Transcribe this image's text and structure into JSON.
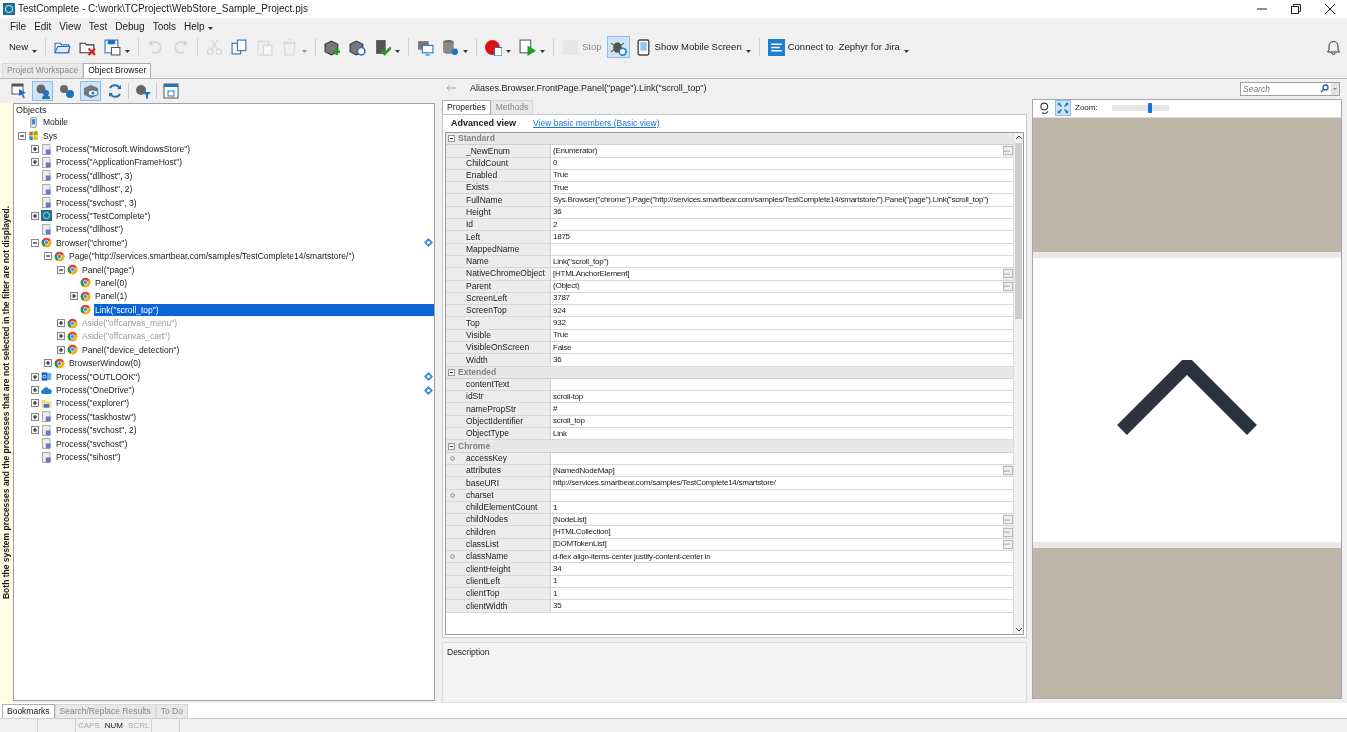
{
  "window": {
    "title": "TestComplete - C:\\work\\TCProject\\WebStore_Sample_Project.pjs"
  },
  "menu": [
    "File",
    "Edit",
    "View",
    "Test",
    "Debug",
    "Tools",
    "Help"
  ],
  "toolbar": [
    {
      "kind": "button",
      "label": "New",
      "disabled": false,
      "pressed": false,
      "dropdown": true
    },
    {
      "kind": "separator"
    },
    {
      "kind": "button",
      "disabled": false,
      "pressed": false,
      "dropdown": false
    },
    {
      "kind": "button",
      "disabled": false,
      "pressed": false,
      "dropdown": false
    },
    {
      "kind": "button",
      "disabled": false,
      "pressed": false,
      "dropdown": true
    },
    {
      "kind": "separator"
    },
    {
      "kind": "button",
      "disabled": true,
      "pressed": false,
      "dropdown": false
    },
    {
      "kind": "button",
      "disabled": true,
      "pressed": false,
      "dropdown": false
    },
    {
      "kind": "separator"
    },
    {
      "kind": "button",
      "disabled": true,
      "pressed": false,
      "dropdown": false
    },
    {
      "kind": "button",
      "disabled": false,
      "pressed": false,
      "dropdown": false
    },
    {
      "kind": "button",
      "disabled": true,
      "pressed": false,
      "dropdown": false
    },
    {
      "kind": "button",
      "disabled": true,
      "pressed": false,
      "dropdown": true
    },
    {
      "kind": "separator"
    },
    {
      "kind": "button",
      "disabled": false,
      "pressed": false,
      "dropdown": false
    },
    {
      "kind": "button",
      "disabled": false,
      "pressed": false,
      "dropdown": false
    },
    {
      "kind": "button",
      "disabled": false,
      "pressed": false,
      "dropdown": true
    },
    {
      "kind": "separator"
    },
    {
      "kind": "button",
      "disabled": false,
      "pressed": false,
      "dropdown": false
    },
    {
      "kind": "button",
      "disabled": false,
      "pressed": false,
      "dropdown": true
    },
    {
      "kind": "separator"
    },
    {
      "kind": "button",
      "disabled": false,
      "pressed": false,
      "dropdown": true
    },
    {
      "kind": "button",
      "disabled": false,
      "pressed": false,
      "dropdown": true
    },
    {
      "kind": "separator"
    },
    {
      "kind": "button",
      "label": "Stop",
      "disabled": true,
      "pressed": false,
      "dropdown": false
    },
    {
      "kind": "button",
      "disabled": false,
      "pressed": true,
      "dropdown": false
    },
    {
      "kind": "button",
      "label": "Show Mobile Screen",
      "disabled": false,
      "pressed": false,
      "dropdown": true
    },
    {
      "kind": "separator"
    },
    {
      "kind": "button",
      "label": "Connect to",
      "target": "Zephyr for Jira",
      "disabled": false,
      "pressed": false,
      "dropdown": true
    }
  ],
  "workspace_tabs": [
    {
      "label": "Project Workspace",
      "selected": false
    },
    {
      "label": "Object Browser",
      "selected": true
    }
  ],
  "object_toolbar": [
    {
      "pressed": false
    },
    {
      "pressed": true
    },
    {
      "pressed": false
    },
    {
      "pressed": true
    },
    {
      "pressed": false
    },
    {
      "pressed": false
    },
    {
      "pressed": false
    }
  ],
  "filter_note": "Both the system processes and the processes that are not selected in the filter are not displayed.",
  "tree": {
    "header": "Objects",
    "items": [
      {
        "label": "Mobile",
        "kind": "mobile",
        "expandable": false,
        "selected": false,
        "dimmed": false,
        "mapped": false
      },
      {
        "label": "Sys",
        "kind": "sys",
        "expandable": true,
        "expanded": true,
        "selected": false,
        "dimmed": false,
        "mapped": false,
        "children": [
          {
            "label": "Process(\"Microsoft.WindowsStore\")",
            "kind": "process",
            "expandable": true,
            "expanded": false,
            "selected": false,
            "dimmed": false,
            "mapped": false
          },
          {
            "label": "Process(\"ApplicationFrameHost\")",
            "kind": "process",
            "expandable": true,
            "expanded": false,
            "selected": false,
            "dimmed": false,
            "mapped": false
          },
          {
            "label": "Process(\"dllhost\", 3)",
            "kind": "process",
            "expandable": false,
            "selected": false,
            "dimmed": false,
            "mapped": false
          },
          {
            "label": "Process(\"dllhost\", 2)",
            "kind": "process",
            "expandable": false,
            "selected": false,
            "dimmed": false,
            "mapped": false
          },
          {
            "label": "Process(\"svchost\", 3)",
            "kind": "process",
            "expandable": false,
            "selected": false,
            "dimmed": false,
            "mapped": false
          },
          {
            "label": "Process(\"TestComplete\")",
            "kind": "app",
            "expandable": true,
            "expanded": false,
            "selected": false,
            "dimmed": false,
            "mapped": false
          },
          {
            "label": "Process(\"dllhost\")",
            "kind": "process",
            "expandable": false,
            "selected": false,
            "dimmed": false,
            "mapped": false
          },
          {
            "label": "Browser(\"chrome\")",
            "kind": "browser",
            "expandable": true,
            "expanded": true,
            "selected": false,
            "dimmed": false,
            "mapped": true,
            "children": [
              {
                "label": "Page(\"http://services.smartbear.com/samples/TestComplete14/smartstore/\")",
                "kind": "browser",
                "expandable": true,
                "expanded": true,
                "selected": false,
                "dimmed": false,
                "mapped": false,
                "children": [
                  {
                    "label": "Panel(\"page\")",
                    "kind": "browser",
                    "expandable": true,
                    "expanded": true,
                    "selected": false,
                    "dimmed": false,
                    "mapped": false,
                    "children": [
                      {
                        "label": "Panel(0)",
                        "kind": "browser",
                        "expandable": false,
                        "selected": false,
                        "dimmed": false,
                        "mapped": false
                      },
                      {
                        "label": "Panel(1)",
                        "kind": "browser",
                        "expandable": true,
                        "expanded": false,
                        "selected": false,
                        "dimmed": false,
                        "mapped": false
                      },
                      {
                        "label": "Link(\"scroll_top\")",
                        "kind": "browser",
                        "expandable": false,
                        "selected": true,
                        "dimmed": false,
                        "mapped": false
                      }
                    ]
                  },
                  {
                    "label": "Aside(\"offcanvas_menu\")",
                    "kind": "browser",
                    "expandable": true,
                    "expanded": false,
                    "selected": false,
                    "dimmed": true,
                    "mapped": false
                  },
                  {
                    "label": "Aside(\"offcanvas_cart\")",
                    "kind": "browser",
                    "expandable": true,
                    "expanded": false,
                    "selected": false,
                    "dimmed": true,
                    "mapped": false
                  },
                  {
                    "label": "Panel(\"device_detection\")",
                    "kind": "browser",
                    "expandable": true,
                    "expanded": false,
                    "selected": false,
                    "dimmed": false,
                    "mapped": false
                  }
                ]
              },
              {
                "label": "BrowserWindow(0)",
                "kind": "browser",
                "expandable": true,
                "expanded": false,
                "selected": false,
                "dimmed": false,
                "mapped": false
              }
            ]
          },
          {
            "label": "Process(\"OUTLOOK\")",
            "kind": "mail",
            "expandable": true,
            "expanded": false,
            "selected": false,
            "dimmed": false,
            "mapped": true
          },
          {
            "label": "Process(\"OneDrive\")",
            "kind": "cloud",
            "expandable": true,
            "expanded": false,
            "selected": false,
            "dimmed": false,
            "mapped": true
          },
          {
            "label": "Process(\"explorer\")",
            "kind": "folder",
            "expandable": true,
            "expanded": false,
            "selected": false,
            "dimmed": false,
            "mapped": false
          },
          {
            "label": "Process(\"taskhostw\")",
            "kind": "process",
            "expandable": true,
            "expanded": false,
            "selected": false,
            "dimmed": false,
            "mapped": false
          },
          {
            "label": "Process(\"svchost\", 2)",
            "kind": "process",
            "expandable": true,
            "expanded": false,
            "selected": false,
            "dimmed": false,
            "mapped": false
          },
          {
            "label": "Process(\"svchost\")",
            "kind": "process",
            "expandable": false,
            "selected": false,
            "dimmed": false,
            "mapped": false
          },
          {
            "label": "Process(\"sihost\")",
            "kind": "process",
            "expandable": false,
            "selected": false,
            "dimmed": false,
            "mapped": false
          }
        ]
      }
    ]
  },
  "properties": {
    "path": "Aliases.Browser.FrontPage.Panel(\"page\").Link(\"scroll_top\")",
    "tabs": [
      {
        "label": "Properties",
        "selected": true
      },
      {
        "label": "Methods",
        "selected": false
      }
    ],
    "view_label": "Advanced view",
    "view_link": "View basic members (Basic view)",
    "groups": [
      {
        "name": "Standard",
        "expanded": true,
        "rows": [
          {
            "name": "_NewEnum",
            "value": "(Enumerator)",
            "button": true,
            "bullet": false
          },
          {
            "name": "ChildCount",
            "value": "0",
            "button": false,
            "bullet": false
          },
          {
            "name": "Enabled",
            "value": "True",
            "button": false,
            "bullet": false
          },
          {
            "name": "Exists",
            "value": "True",
            "button": false,
            "bullet": false
          },
          {
            "name": "FullName",
            "value": "Sys.Browser(\"chrome\").Page(\"http://services.smartbear.com/samples/TestComplete14/smartstore/\").Panel(\"page\").Link(\"scroll_top\")",
            "button": false,
            "bullet": false
          },
          {
            "name": "Height",
            "value": "36",
            "button": false,
            "bullet": false
          },
          {
            "name": "Id",
            "value": "2",
            "button": false,
            "bullet": false
          },
          {
            "name": "Left",
            "value": "1875",
            "button": false,
            "bullet": false
          },
          {
            "name": "MappedName",
            "button": false,
            "bullet": false
          },
          {
            "name": "Name",
            "value": "Link(\"scroll_top\")",
            "button": false,
            "bullet": false
          },
          {
            "name": "NativeChromeObject",
            "value": "[HTMLAnchorElement]",
            "button": true,
            "bullet": false
          },
          {
            "name": "Parent",
            "value": "(Object)",
            "button": true,
            "bullet": false
          },
          {
            "name": "ScreenLeft",
            "value": "3787",
            "button": false,
            "bullet": false
          },
          {
            "name": "ScreenTop",
            "value": "924",
            "button": false,
            "bullet": false
          },
          {
            "name": "Top",
            "value": "932",
            "button": false,
            "bullet": false
          },
          {
            "name": "Visible",
            "value": "True",
            "button": false,
            "bullet": false
          },
          {
            "name": "VisibleOnScreen",
            "value": "False",
            "button": false,
            "bullet": false
          },
          {
            "name": "Width",
            "value": "36",
            "button": false,
            "bullet": false
          }
        ]
      },
      {
        "name": "Extended",
        "expanded": true,
        "rows": [
          {
            "name": "contentText",
            "button": false,
            "bullet": false
          },
          {
            "name": "idStr",
            "value": "scroll-top",
            "button": false,
            "bullet": false
          },
          {
            "name": "namePropStr",
            "value": "#",
            "button": false,
            "bullet": false
          },
          {
            "name": "ObjectIdentifier",
            "value": "scroll_top",
            "button": false,
            "bullet": false
          },
          {
            "name": "ObjectType",
            "value": "Link",
            "button": false,
            "bullet": false
          }
        ]
      },
      {
        "name": "Chrome",
        "expanded": true,
        "rows": [
          {
            "name": "accessKey",
            "button": false,
            "bullet": true
          },
          {
            "name": "attributes",
            "value": "[NamedNodeMap]",
            "button": true,
            "bullet": false
          },
          {
            "name": "baseURI",
            "value": "http://services.smartbear.com/samples/TestComplete14/smartstore/",
            "button": false,
            "bullet": false
          },
          {
            "name": "charset",
            "button": false,
            "bullet": true
          },
          {
            "name": "childElementCount",
            "value": "1",
            "button": false,
            "bullet": false
          },
          {
            "name": "childNodes",
            "value": "[NodeList]",
            "button": true,
            "bullet": false
          },
          {
            "name": "children",
            "value": "[HTMLCollection]",
            "button": true,
            "bullet": false
          },
          {
            "name": "classList",
            "value": "[DOMTokenList]",
            "button": true,
            "bullet": false
          },
          {
            "name": "className",
            "value": "d-flex align-items-center justify-content-center in",
            "button": false,
            "bullet": true
          },
          {
            "name": "clientHeight",
            "value": "34",
            "button": false,
            "bullet": false
          },
          {
            "name": "clientLeft",
            "value": "1",
            "button": false,
            "bullet": false
          },
          {
            "name": "clientTop",
            "value": "1",
            "button": false,
            "bullet": false
          },
          {
            "name": "clientWidth",
            "value": "35",
            "button": false,
            "bullet": false
          }
        ]
      }
    ],
    "description_label": "Description"
  },
  "preview": {
    "search": {
      "placeholder": "Search"
    },
    "tools": [
      {
        "pressed": false
      },
      {
        "pressed": true
      }
    ],
    "zoom_label": "Zoom:",
    "zoom": {
      "level": 0.68
    }
  },
  "bottom_tabs": [
    {
      "label": "Bookmarks",
      "selected": true
    },
    {
      "label": "Search/Replace Results",
      "selected": false
    },
    {
      "label": "To Do",
      "selected": false
    }
  ],
  "status_bar": [
    {
      "label": "CAPS",
      "on": false
    },
    {
      "label": "NUM",
      "on": true
    },
    {
      "label": "SCRL",
      "on": false
    }
  ]
}
